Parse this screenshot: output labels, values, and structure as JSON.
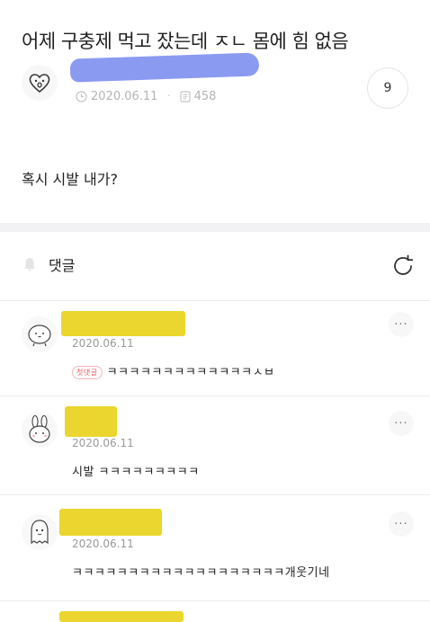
{
  "post": {
    "title": "어제 구충제 먹고 잤는데 ㅈㄴ 몸에 힘 없음",
    "date": "2020.06.11",
    "views": "458",
    "comment_count": "9",
    "body": "혹시 시발 내가?"
  },
  "comments_header": {
    "label": "댓글"
  },
  "comments": [
    {
      "date": "2020.06.11",
      "badge": "첫댓글",
      "text": "ㅋㅋㅋㅋㅋㅋㅋㅋㅋㅋㅋㅋㅋㅅㅂ",
      "more": "···"
    },
    {
      "date": "2020.06.11",
      "text": "시발 ㅋㅋㅋㅋㅋㅋㅋㅋㅋ",
      "more": "···"
    },
    {
      "date": "2020.06.11",
      "text": "ㅋㅋㅋㅋㅋㅋㅋㅋㅋㅋㅋㅋㅋㅋㅋㅋㅋㅋㅋ개웃기네",
      "more": "···"
    }
  ],
  "icons": {
    "author_avatar": "heart-face-icon",
    "date": "clock-icon",
    "views": "document-icon",
    "comments": "bell-icon",
    "refresh": "refresh-icon"
  },
  "colors": {
    "redaction_blue": "#7e8ff0",
    "redaction_yellow": "#e8d21c",
    "badge_red": "#e25a5a"
  }
}
